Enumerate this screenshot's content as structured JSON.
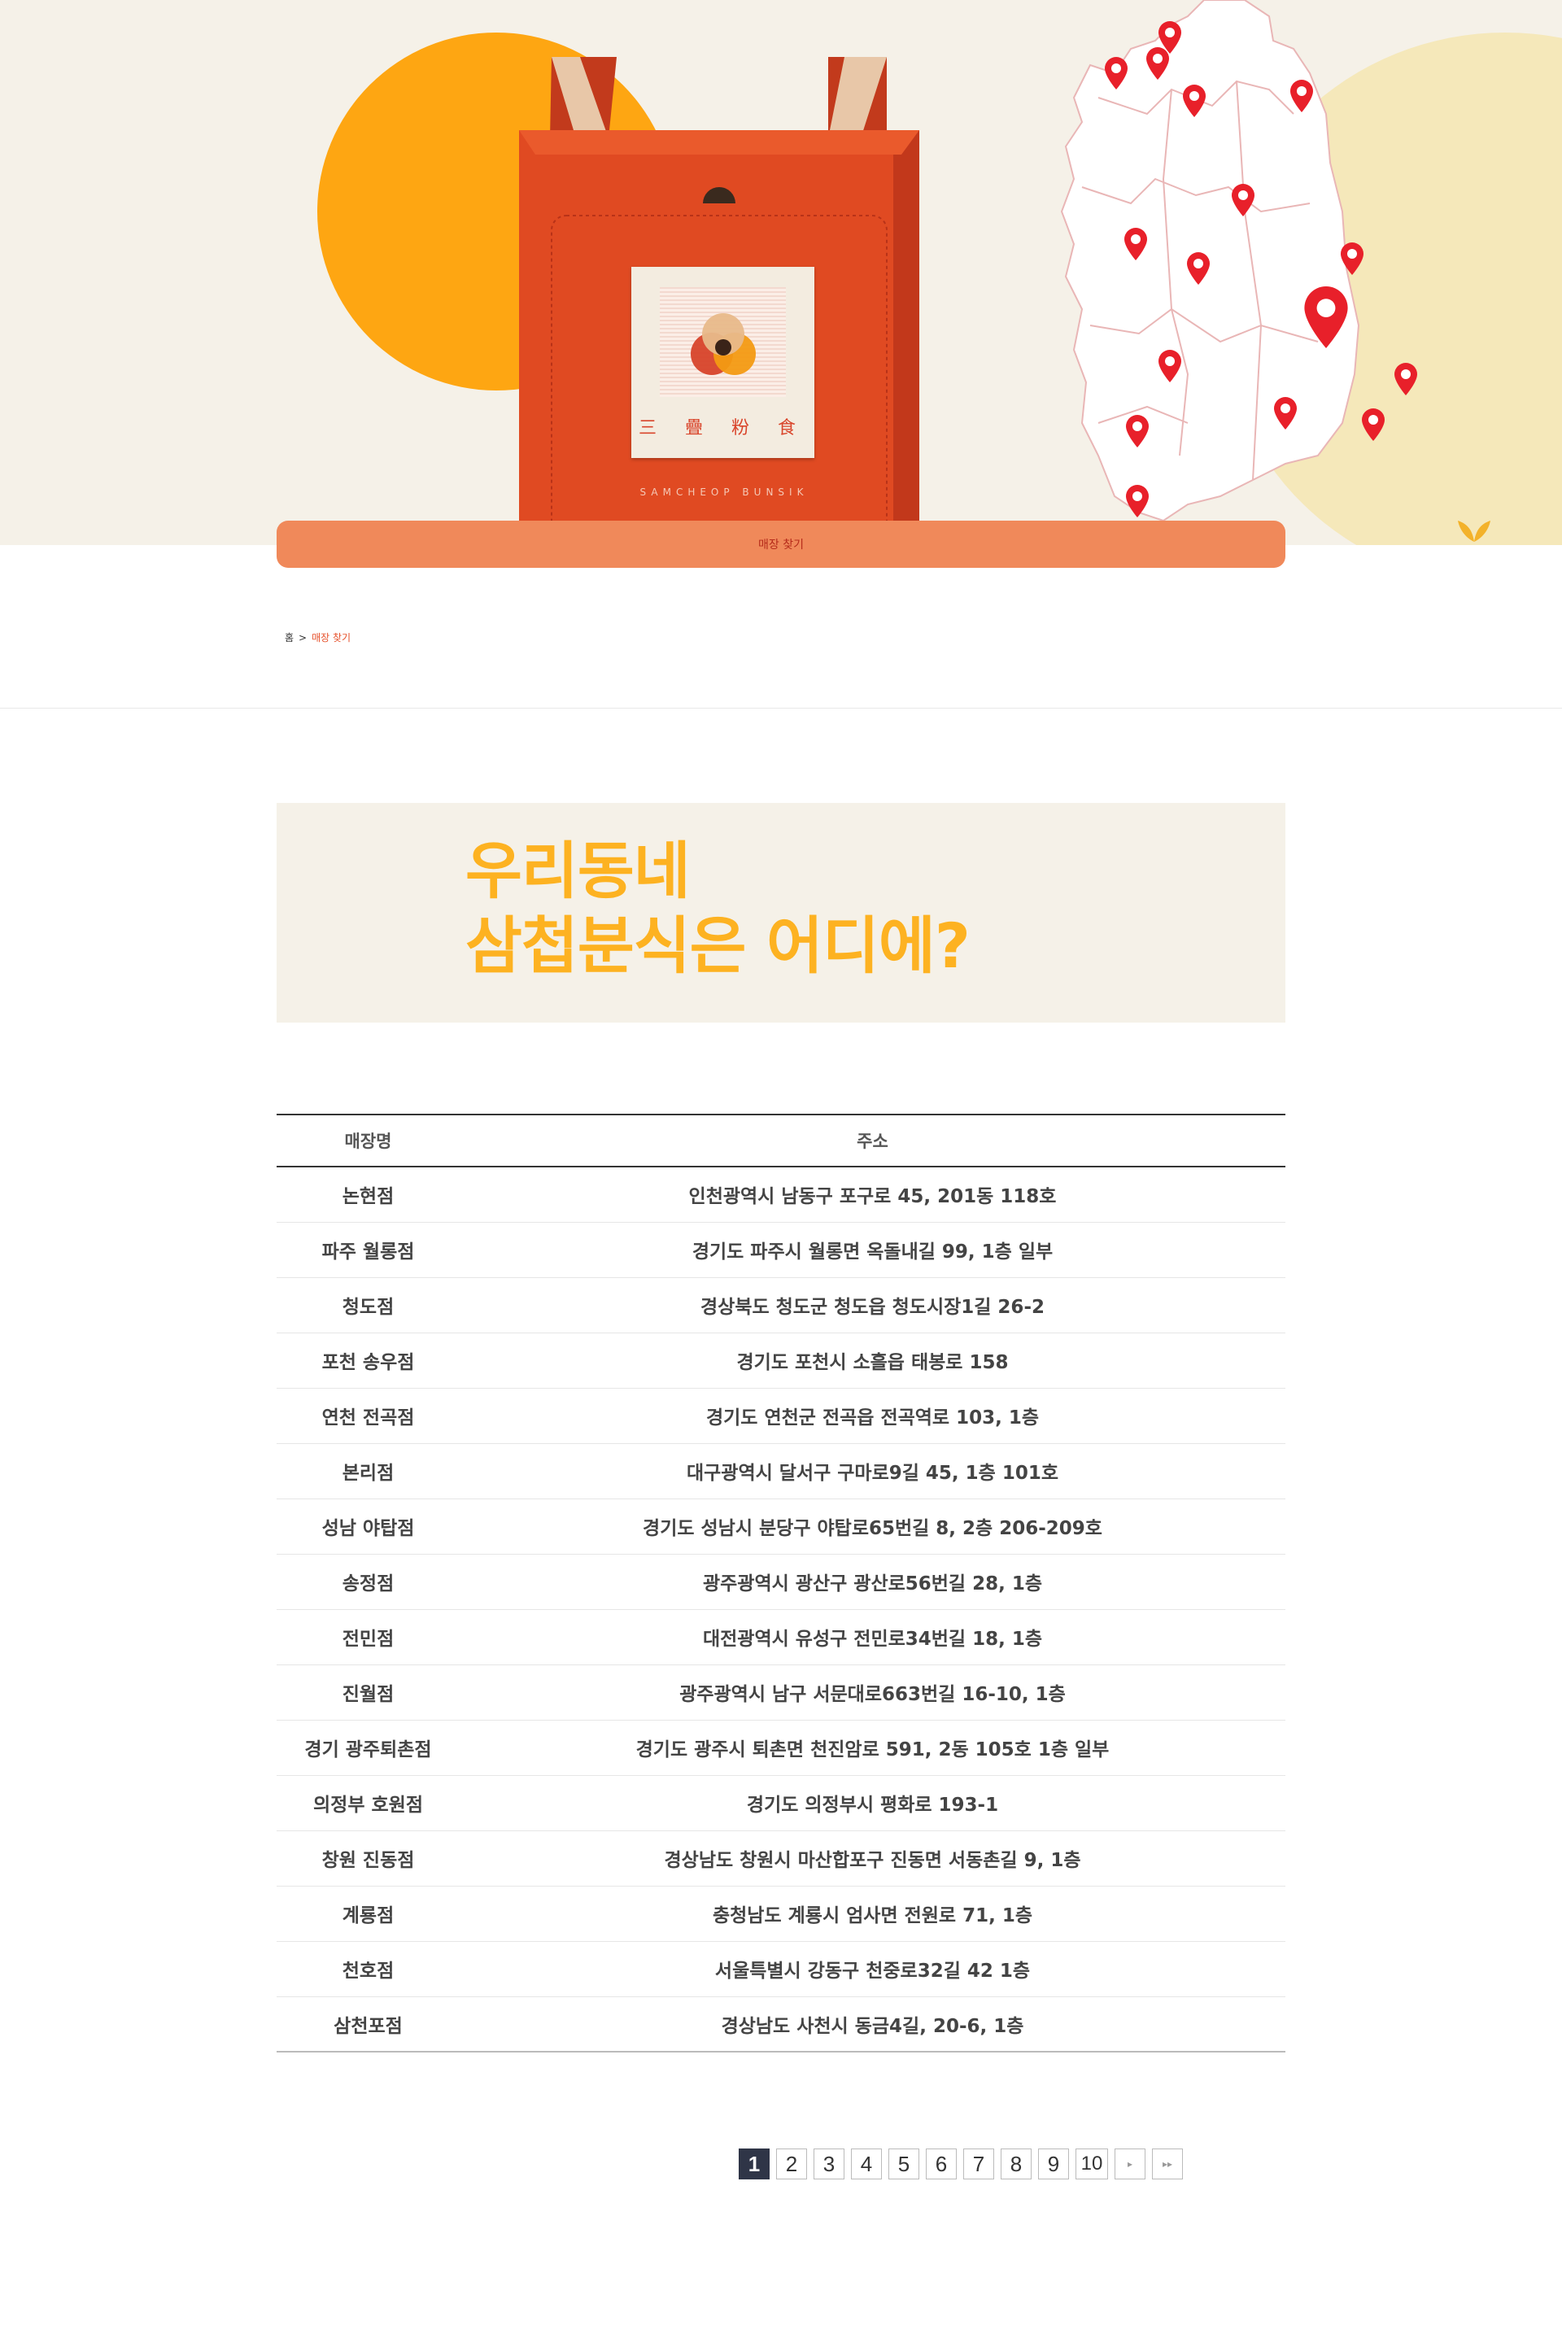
{
  "hero": {
    "box_hanja": "三 疊 粉 食",
    "box_brand": "SAMCHEOP BUNSIK",
    "find_store_label": "매장 찾기"
  },
  "breadcrumb": {
    "home": "홈",
    "separator": ">",
    "current": "매장 찾기"
  },
  "title": {
    "line1": "우리동네",
    "line2": "삼첩분식은 어디에?"
  },
  "table": {
    "headers": {
      "name": "매장명",
      "address": "주소"
    },
    "rows": [
      {
        "name": "논현점",
        "address": "인천광역시 남동구 포구로 45, 201동 118호"
      },
      {
        "name": "파주 월롱점",
        "address": "경기도 파주시 월롱면 옥돌내길 99, 1층 일부"
      },
      {
        "name": "청도점",
        "address": "경상북도 청도군 청도읍 청도시장1길 26-2"
      },
      {
        "name": "포천 송우점",
        "address": "경기도 포천시 소흘읍 태봉로 158"
      },
      {
        "name": "연천 전곡점",
        "address": "경기도 연천군 전곡읍 전곡역로 103, 1층"
      },
      {
        "name": "본리점",
        "address": "대구광역시 달서구 구마로9길 45, 1층 101호"
      },
      {
        "name": "성남 야탑점",
        "address": "경기도 성남시 분당구 야탑로65번길 8, 2층 206-209호"
      },
      {
        "name": "송정점",
        "address": "광주광역시 광산구 광산로56번길 28, 1층"
      },
      {
        "name": "전민점",
        "address": "대전광역시 유성구 전민로34번길 18, 1층"
      },
      {
        "name": "진월점",
        "address": "광주광역시 남구 서문대로663번길 16-10, 1층"
      },
      {
        "name": "경기 광주퇴촌점",
        "address": "경기도 광주시 퇴촌면 천진암로 591, 2동 105호 1층 일부"
      },
      {
        "name": "의정부 호원점",
        "address": "경기도 의정부시 평화로 193-1"
      },
      {
        "name": "창원 진동점",
        "address": "경상남도 창원시 마산합포구 진동면 서동촌길 9, 1층"
      },
      {
        "name": "계룡점",
        "address": "충청남도 계룡시 엄사면 전원로 71, 1층"
      },
      {
        "name": "천호점",
        "address": "서울특별시 강동구 천중로32길 42 1층"
      },
      {
        "name": "삼천포점",
        "address": "경상남도 사천시 동금4길, 20-6, 1층"
      }
    ]
  },
  "pagination": {
    "current": 1,
    "pages": [
      "1",
      "2",
      "3",
      "4",
      "5",
      "6",
      "7",
      "8",
      "9",
      "10"
    ],
    "next_icon": "next-page-icon",
    "last_icon": "last-page-icon"
  },
  "colors": {
    "accent_orange": "#fea612",
    "find_bar": "#f0895a",
    "title_yellow": "#fdb221",
    "pin_red": "#e8202a",
    "active_page": "#2f3547"
  }
}
